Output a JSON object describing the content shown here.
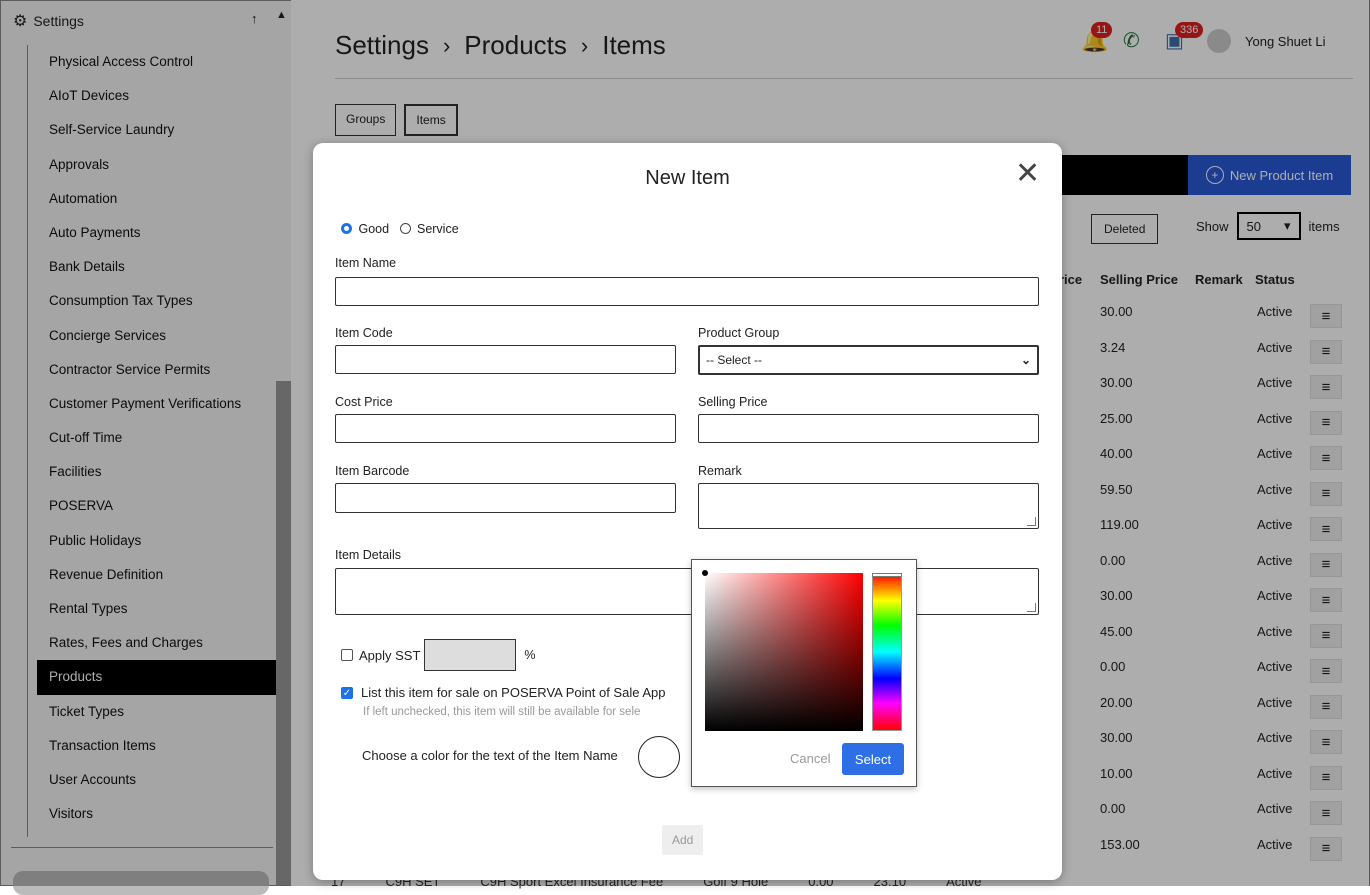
{
  "sidebar": {
    "title": "Settings",
    "pin_glyph": "↑",
    "collapse_glyph": "▲",
    "items": [
      {
        "label": "Physical Access Control"
      },
      {
        "label": "AIoT Devices"
      },
      {
        "label": "Self-Service Laundry"
      },
      {
        "label": "Approvals"
      },
      {
        "label": "Automation"
      },
      {
        "label": "Auto Payments"
      },
      {
        "label": "Bank Details"
      },
      {
        "label": "Consumption Tax Types"
      },
      {
        "label": "Concierge Services"
      },
      {
        "label": "Contractor Service Permits"
      },
      {
        "label": "Customer Payment Verifications"
      },
      {
        "label": "Cut-off Time"
      },
      {
        "label": "Facilities"
      },
      {
        "label": "POSERVA"
      },
      {
        "label": "Public Holidays"
      },
      {
        "label": "Revenue Definition"
      },
      {
        "label": "Rental Types"
      },
      {
        "label": "Rates, Fees and Charges"
      },
      {
        "label": "Products",
        "active": true
      },
      {
        "label": "Ticket Types"
      },
      {
        "label": "Transaction Items"
      },
      {
        "label": "User Accounts"
      },
      {
        "label": "Visitors"
      }
    ]
  },
  "header": {
    "breadcrumb": [
      "Settings",
      "Products",
      "Items"
    ],
    "separator": "›",
    "notifications_count": "11",
    "messages_count": "336",
    "user_name": "Yong Shuet Li",
    "icons": {
      "bell": "bell-icon",
      "phone": "phone-icon",
      "inbox": "inbox-icon"
    }
  },
  "tabs": [
    {
      "label": "Groups"
    },
    {
      "label": "Items"
    }
  ],
  "toolbar": {
    "new_button": "New Product Item",
    "deleted_button": "Deleted",
    "show_label": "Show",
    "show_value": "50",
    "items_label": "items"
  },
  "table": {
    "cost_price_header_fragment": "rice",
    "headers": {
      "selling_price": "Selling Price",
      "remark": "Remark",
      "status": "Status"
    },
    "rows": [
      {
        "selling_price": "30.00",
        "status": "Active"
      },
      {
        "selling_price": "3.24",
        "status": "Active"
      },
      {
        "selling_price": "30.00",
        "status": "Active"
      },
      {
        "selling_price": "25.00",
        "status": "Active"
      },
      {
        "selling_price": "40.00",
        "status": "Active"
      },
      {
        "selling_price": "59.50",
        "status": "Active"
      },
      {
        "selling_price": "119.00",
        "status": "Active"
      },
      {
        "selling_price": "0.00",
        "status": "Active"
      },
      {
        "selling_price": "30.00",
        "status": "Active"
      },
      {
        "selling_price": "45.00",
        "status": "Active"
      },
      {
        "selling_price": "0.00",
        "status": "Active"
      },
      {
        "selling_price": "20.00",
        "status": "Active"
      },
      {
        "selling_price": "30.00",
        "status": "Active"
      },
      {
        "selling_price": "10.00",
        "status": "Active"
      },
      {
        "selling_price": "0.00",
        "status": "Active"
      },
      {
        "selling_price": "153.00",
        "status": "Active"
      }
    ],
    "partial_row": {
      "no": "17",
      "code": "C9H SET",
      "name": "C9H Sport Excel Insurance Fee",
      "group": "Golf 9 Hole",
      "cost": "0.00",
      "selling": "23.10",
      "status": "Active"
    }
  },
  "modal": {
    "title": "New Item",
    "type_good": "Good",
    "type_service": "Service",
    "item_name_label": "Item Name",
    "item_code_label": "Item Code",
    "product_group_label": "Product Group",
    "product_group_value": "-- Select --",
    "cost_price_label": "Cost Price",
    "selling_price_label": "Selling Price",
    "item_barcode_label": "Item Barcode",
    "remark_label": "Remark",
    "item_details_label": "Item Details",
    "apply_sst_label": "Apply SST",
    "percent": "%",
    "list_for_sale_label": "List this item for sale on POSERVA Point of Sale App",
    "list_for_sale_hint": "If left unchecked, this item will still be available for sele",
    "choose_color_label": "Choose a color for the text of the Item Name",
    "add_button": "Add"
  },
  "color_picker": {
    "cancel": "Cancel",
    "select": "Select",
    "hue_color": "#ff0000",
    "select_color": "#2f6fe6"
  }
}
